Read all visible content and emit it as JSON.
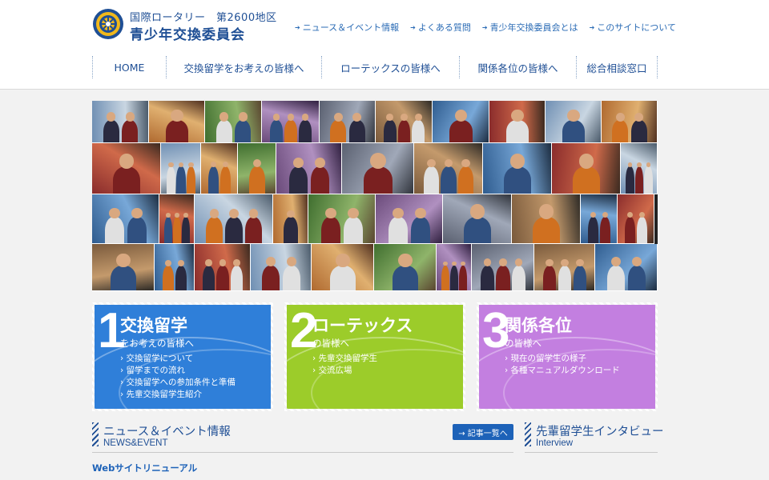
{
  "header": {
    "org_line1": "国際ロータリー　第2600地区",
    "org_line2": "青少年交換委員会",
    "logo_icon": "rotary-wheel-icon"
  },
  "top_links": [
    {
      "label": "ニュース＆イベント情報"
    },
    {
      "label": "よくある質問"
    },
    {
      "label": "青少年交換委員会とは"
    },
    {
      "label": "このサイトについて"
    }
  ],
  "nav": [
    {
      "label": "HOME"
    },
    {
      "label": "交換留学をお考えの皆様へ"
    },
    {
      "label": "ローテックスの皆様へ"
    },
    {
      "label": "関係各位の皆様へ"
    },
    {
      "label": "総合相談窓口"
    }
  ],
  "features": [
    {
      "num": "1",
      "title": "交換留学",
      "sub": "をお考えの皆様へ",
      "color": "#2f7fd9",
      "items": [
        "交換留学について",
        "留学までの流れ",
        "交換留学への参加条件と準備",
        "先輩交換留学生紹介"
      ]
    },
    {
      "num": "2",
      "title": "ローテックス",
      "sub": "の皆様へ",
      "color": "#9ccc2a",
      "items": [
        "先輩交換留学生",
        "交流広場"
      ]
    },
    {
      "num": "3",
      "title": "関係各位",
      "sub": "の皆様へ",
      "color": "#c37fe0",
      "items": [
        "現在の留学生の様子",
        "各種マニュアルダウンロード"
      ]
    }
  ],
  "news": {
    "title": "ニュース＆イベント情報",
    "subtitle": "NEWS&EVENT",
    "list_button": "→ 記事一覧へ",
    "item": "Webサイトリニューアル"
  },
  "interview": {
    "title": "先輩留学生インタビュー",
    "subtitle": "Interview"
  }
}
